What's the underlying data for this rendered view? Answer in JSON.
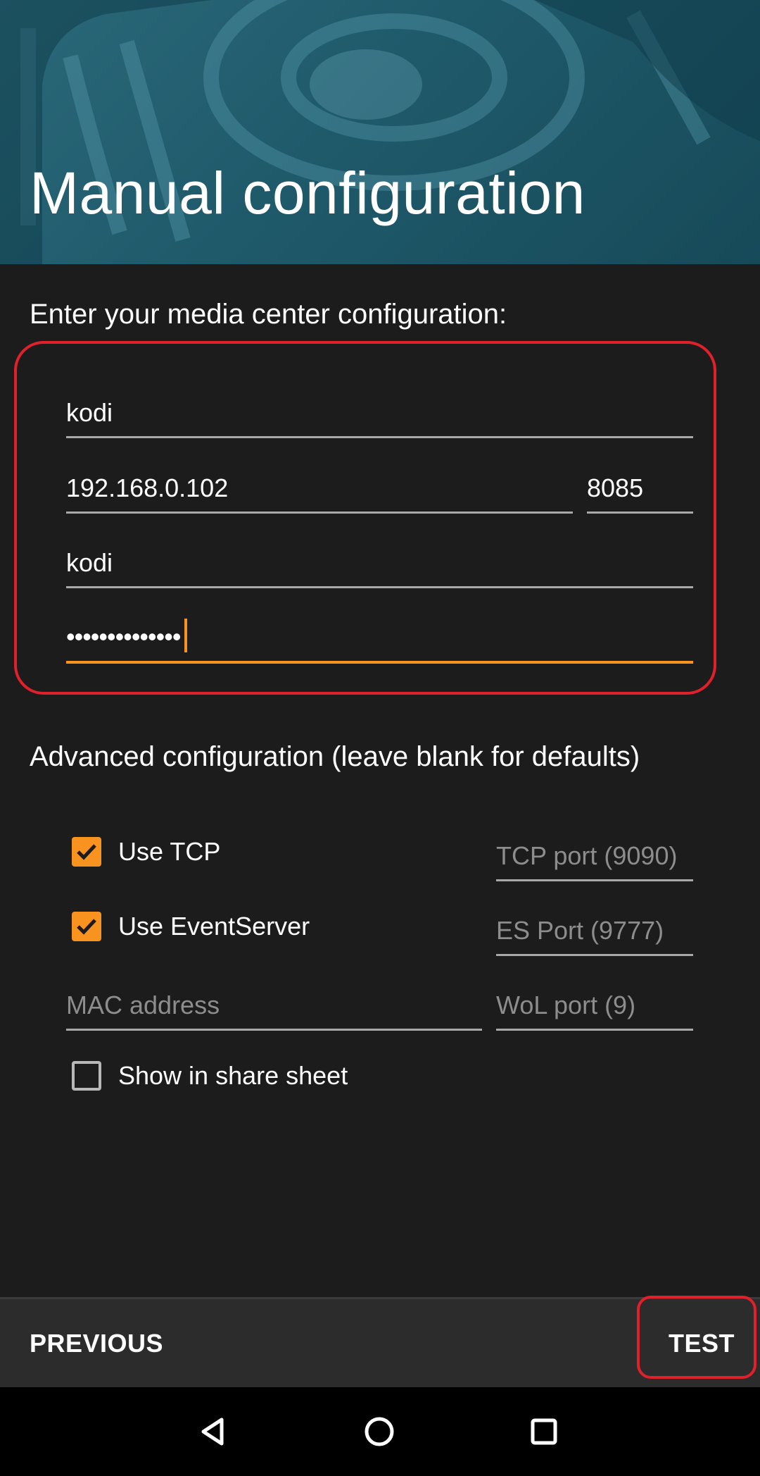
{
  "header": {
    "title": "Manual configuration"
  },
  "main": {
    "intro_label": "Enter your media center configuration:",
    "name_value": "kodi",
    "address_value": "192.168.0.102",
    "port_value": "8085",
    "username_value": "kodi",
    "password_value": "••••••••••••••"
  },
  "advanced": {
    "label": "Advanced configuration (leave blank for defaults)",
    "use_tcp": {
      "label": "Use TCP",
      "checked": true
    },
    "tcp_port_placeholder": "TCP port (9090)",
    "use_eventserver": {
      "label": "Use EventServer",
      "checked": true
    },
    "es_port_placeholder": "ES Port (9777)",
    "mac_placeholder": "MAC address",
    "wol_port_placeholder": "WoL port (9)",
    "share_sheet": {
      "label": "Show in share sheet",
      "checked": false
    }
  },
  "footer": {
    "previous_label": "PREVIOUS",
    "test_label": "TEST"
  },
  "colors": {
    "accent": "#f7931e",
    "highlight": "#e0212b",
    "header": "#1f5a6b",
    "background": "#1c1c1c"
  },
  "icons": {
    "back": "back-triangle-icon",
    "home": "home-circle-icon",
    "recents": "recents-square-icon",
    "check": "checkmark-icon"
  }
}
